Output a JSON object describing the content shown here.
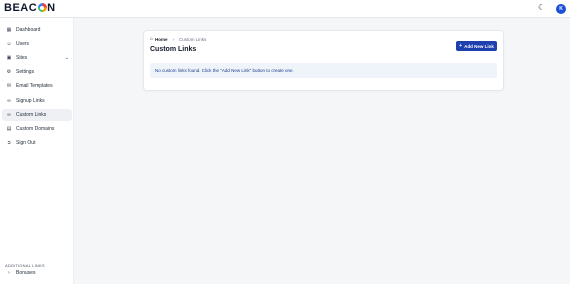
{
  "header": {
    "logo_text_before": "BEAC",
    "logo_text_after": "N",
    "theme_icon": "moon-icon",
    "avatar_initial": "K"
  },
  "sidebar": {
    "items": [
      {
        "label": "Dashboard",
        "icon": "grid-icon"
      },
      {
        "label": "Users",
        "icon": "users-icon"
      },
      {
        "label": "Sites",
        "icon": "sites-icon"
      },
      {
        "label": "Settings",
        "icon": "gear-icon"
      },
      {
        "label": "Email Templates",
        "icon": "mail-icon"
      },
      {
        "label": "Signup Links",
        "icon": "link-icon"
      },
      {
        "label": "Custom Links",
        "icon": "link-icon"
      },
      {
        "label": "Custom Domains",
        "icon": "domain-icon"
      },
      {
        "label": "Sign Out",
        "icon": "sign-out-icon"
      }
    ],
    "active_item": "Custom Links",
    "section_label": "ADDITIONAL LINKS",
    "extra_item": {
      "label": "Bonuses",
      "icon": "chevron-right-icon"
    }
  },
  "main": {
    "breadcrumb": {
      "home": "Home",
      "current": "Custom Links"
    },
    "title": "Custom Links",
    "add_button_label": "Add New Link",
    "empty_message": "No custom links found. Click the \"Add New Link\" button to create one."
  }
}
